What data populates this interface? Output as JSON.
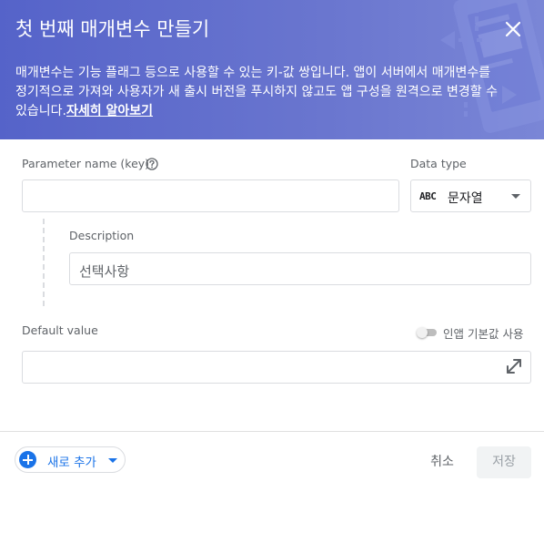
{
  "header": {
    "title": "첫 번째 매개변수 만들기",
    "description": "매개변수는 기능 플래그 등으로 사용할 수 있는 키-값 쌍입니다. 앱이 서버에서 매개변수를 정기적으로 가져와 사용자가 새 출시 버전을 푸시하지 않고도 앱 구성을 원격으로 변경할 수 있습니다.",
    "learn_more": "자세히 알아보기",
    "close_icon": "close-icon"
  },
  "form": {
    "param_label": "Parameter name (key)",
    "param_value": "",
    "help_icon": "help-icon",
    "data_type_label": "Data type",
    "data_type_glyph": "ABC",
    "data_type_value": "문자열",
    "description_label": "Description",
    "description_placeholder": "선택사항",
    "default_value_label": "Default value",
    "default_value": "",
    "inapp_default_label": "인앱 기본값 사용",
    "inapp_default_enabled": false,
    "expand_icon": "expand-icon"
  },
  "footer": {
    "add_new": "새로 추가",
    "cancel": "취소",
    "save": "저장"
  },
  "colors": {
    "header_bg": "#5a67cb",
    "accent": "#1a73e8"
  }
}
